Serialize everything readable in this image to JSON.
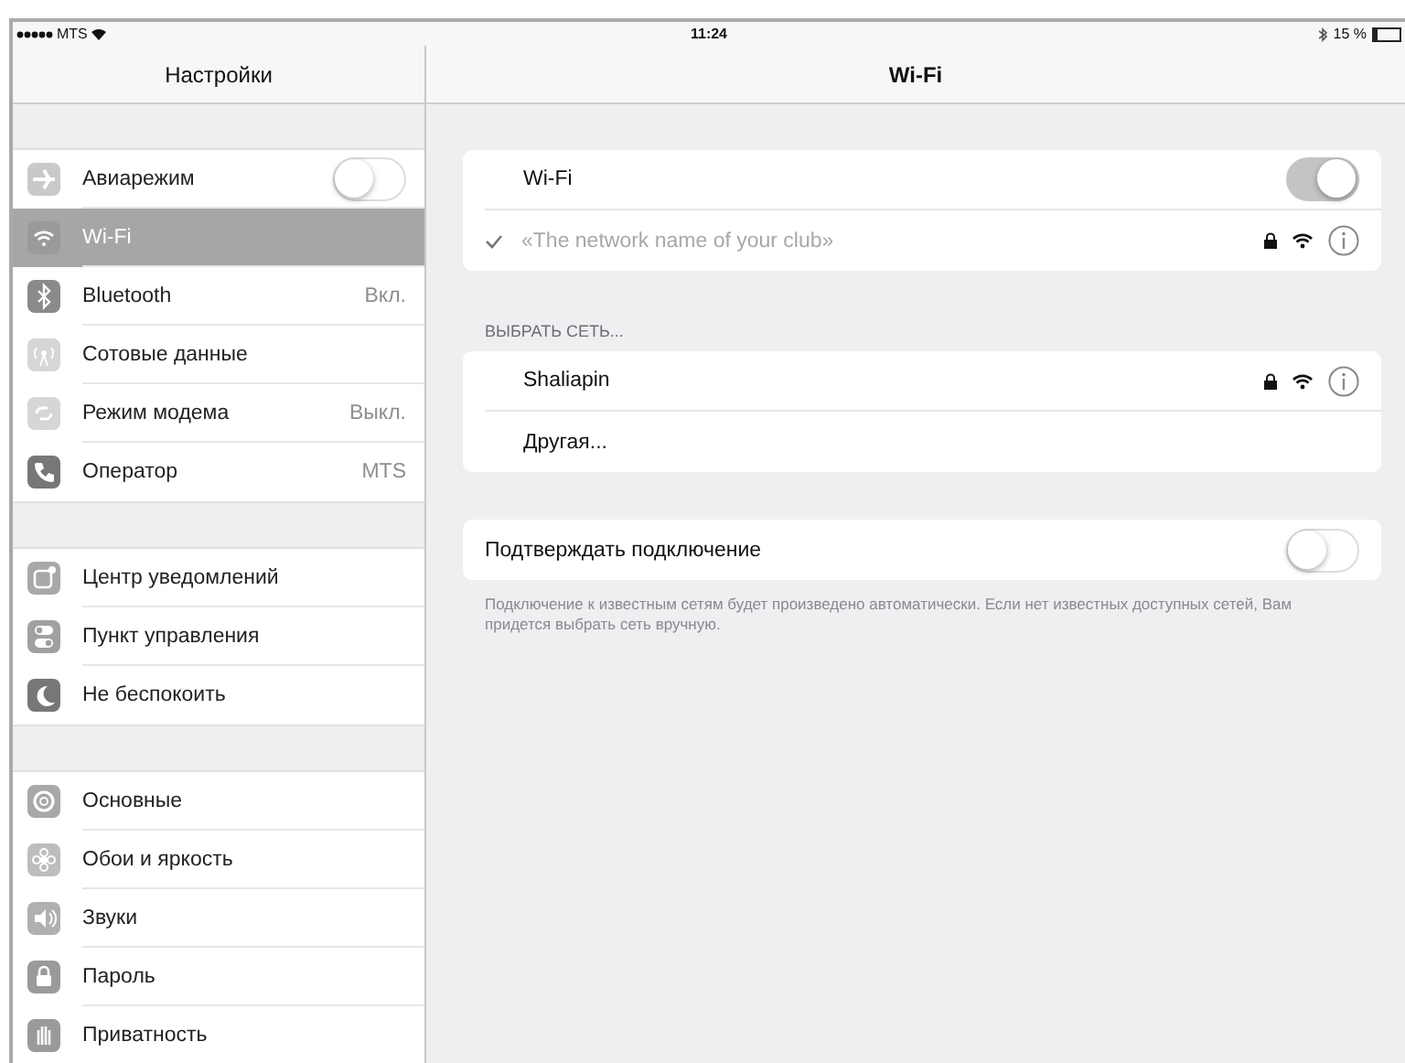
{
  "status_bar": {
    "carrier": "MTS",
    "time": "11:24",
    "battery": "15 %"
  },
  "sidebar": {
    "title": "Настройки",
    "groups": [
      [
        {
          "label": "Авиарежим",
          "kind": "toggle",
          "on": false,
          "selected": false
        },
        {
          "label": "Wi-Fi",
          "kind": "plain",
          "selected": true
        },
        {
          "label": "Bluetooth",
          "kind": "value",
          "value": "Вкл.",
          "selected": false
        },
        {
          "label": "Сотовые данные",
          "kind": "plain",
          "selected": false
        },
        {
          "label": "Режим модема",
          "kind": "value",
          "value": "Выкл.",
          "selected": false
        },
        {
          "label": "Оператор",
          "kind": "value",
          "value": "MTS",
          "selected": false
        }
      ],
      [
        {
          "label": "Центр уведомлений",
          "kind": "plain",
          "selected": false
        },
        {
          "label": "Пункт управления",
          "kind": "plain",
          "selected": false
        },
        {
          "label": "Не беспокоить",
          "kind": "plain",
          "selected": false
        }
      ],
      [
        {
          "label": "Основные",
          "kind": "plain",
          "selected": false
        },
        {
          "label": "Обои и яркость",
          "kind": "plain",
          "selected": false
        },
        {
          "label": "Звуки",
          "kind": "plain",
          "selected": false
        },
        {
          "label": "Пароль",
          "kind": "plain",
          "selected": false
        },
        {
          "label": "Приватность",
          "kind": "plain",
          "selected": false
        }
      ]
    ]
  },
  "wifi": {
    "title": "Wi-Fi",
    "toggle": {
      "label": "Wi-Fi",
      "on": true
    },
    "current_network": {
      "name": "«The network name of your club»",
      "checked": true
    },
    "section_header": "ВЫБРАТЬ СЕТЬ...",
    "networks": [
      {
        "name": "Shaliapin",
        "kind": "network"
      },
      {
        "name": "Другая...",
        "kind": "other"
      }
    ],
    "ask_to_join": {
      "label": "Подтверждать подключение",
      "on": false
    },
    "footnote": "Подключение к известным сетям будет произведено автоматически. Если нет известных доступных сетей, Вам придется выбрать сеть вручную."
  }
}
